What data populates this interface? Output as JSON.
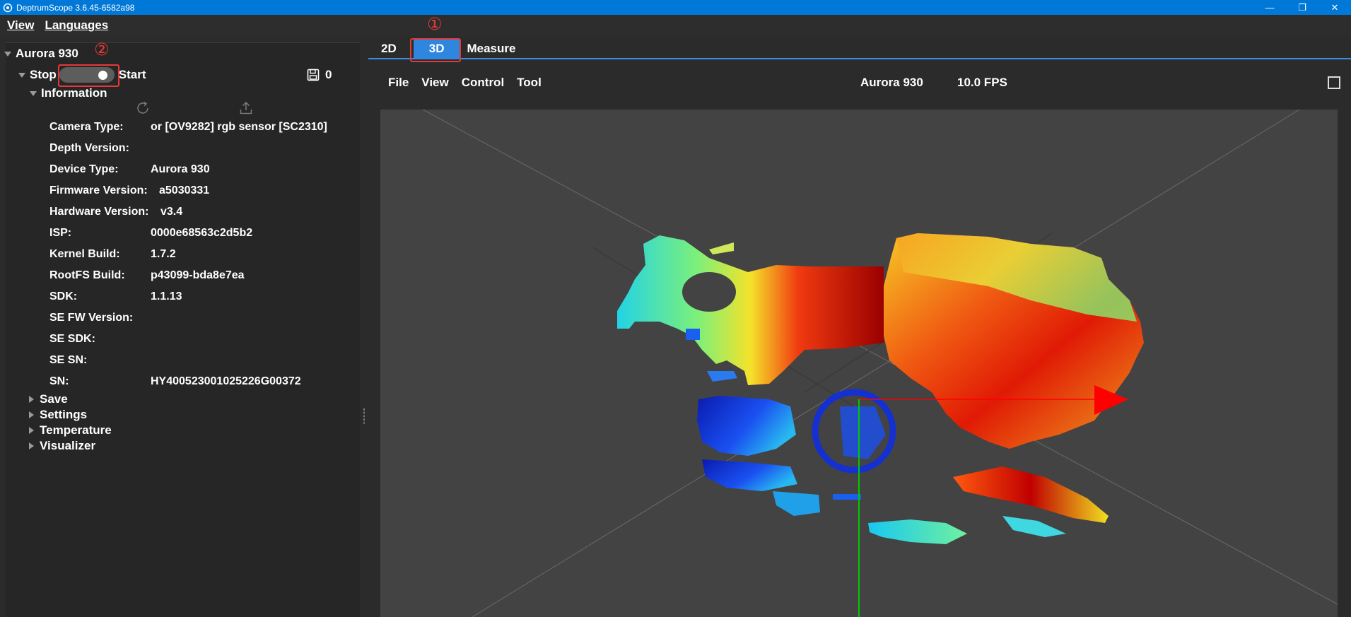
{
  "window": {
    "title": "DeptrumScope 3.6.45-6582a98",
    "controls": {
      "minimize": "—",
      "restore": "❐",
      "close": "✕"
    }
  },
  "menubar": {
    "items": [
      "View",
      "Languages"
    ]
  },
  "device_panel": {
    "device_name": "Aurora 930",
    "stop_label": "Stop",
    "start_label": "Start",
    "frame_count": "0",
    "information_label": "Information",
    "info_rows": [
      {
        "key": "Camera Type:",
        "value": "or [OV9282]  rgb sensor [SC2310]"
      },
      {
        "key": "Depth Version:",
        "value": ""
      },
      {
        "key": "Device Type:",
        "value": "Aurora 930"
      },
      {
        "key": "Firmware Version:",
        "value": "a5030331"
      },
      {
        "key": "Hardware Version:",
        "value": "v3.4"
      },
      {
        "key": "ISP:",
        "value": "0000e68563c2d5b2"
      },
      {
        "key": "Kernel Build:",
        "value": "1.7.2"
      },
      {
        "key": "RootFS Build:",
        "value": "p43099-bda8e7ea"
      },
      {
        "key": "SDK:",
        "value": "1.1.13"
      },
      {
        "key": "SE FW Version:",
        "value": ""
      },
      {
        "key": "SE SDK:",
        "value": ""
      },
      {
        "key": "SE SN:",
        "value": ""
      },
      {
        "key": "SN:",
        "value": "HY400523001025226G00372"
      }
    ],
    "sections": [
      "Save",
      "Settings",
      "Temperature",
      "Visualizer"
    ]
  },
  "annotations": {
    "marker1": "①",
    "marker2": "②",
    "color": "#e53935"
  },
  "tabs": [
    {
      "label": "2D",
      "active": false
    },
    {
      "label": "3D",
      "active": true
    },
    {
      "label": "Measure",
      "active": false
    }
  ],
  "viewer": {
    "menu": [
      "File",
      "View",
      "Control",
      "Tool"
    ],
    "device": "Aurora 930",
    "fps": "10.0 FPS"
  },
  "colors": {
    "accent": "#2f86de",
    "titlebar": "#0078d7",
    "axis_x": "#ff0000",
    "axis_y": "#00c800"
  },
  "icons": [
    "refresh-icon",
    "upload-icon",
    "save-icon",
    "maximize-icon"
  ]
}
